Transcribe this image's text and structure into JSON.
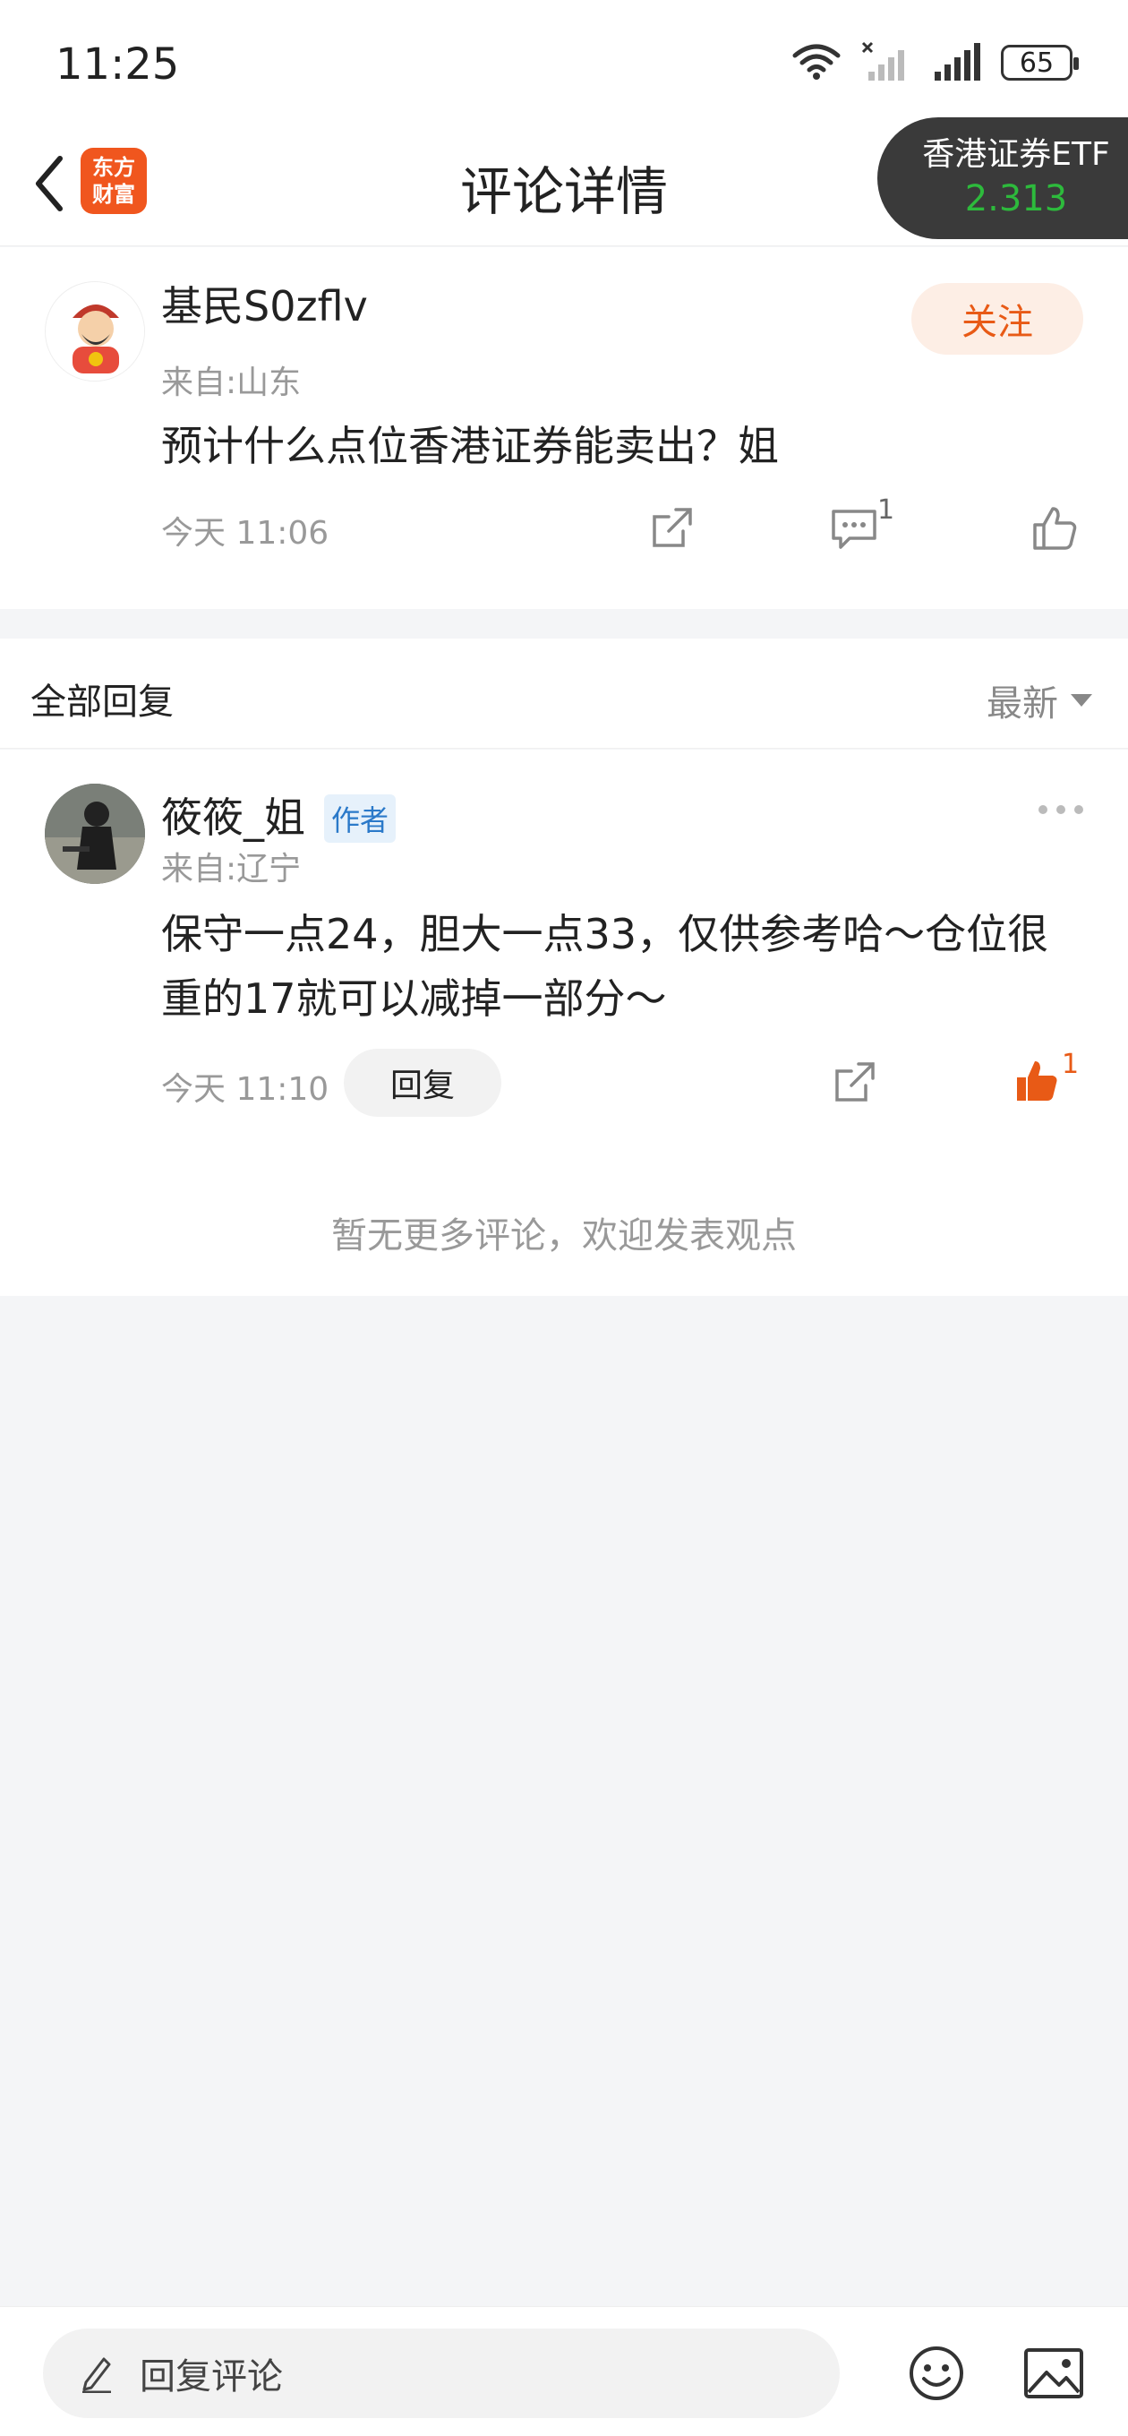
{
  "status_bar": {
    "time": "11:25",
    "battery": "65"
  },
  "nav": {
    "title": "评论详情",
    "logo_line1": "东方",
    "logo_line2": "财富",
    "stock_name": "香港证券ETF",
    "stock_price": "2.313"
  },
  "post": {
    "username": "基民S0zflv",
    "from": "来自:山东",
    "content": "预计什么点位香港证券能卖出？姐",
    "time": "今天 11:06",
    "follow_label": "关注",
    "comment_count": "1"
  },
  "replies_header": {
    "title": "全部回复",
    "sort_label": "最新"
  },
  "reply": {
    "username": "筱筱_姐",
    "author_tag": "作者",
    "from": "来自:辽宁",
    "content": "保守一点24，胆大一点33，仅供参考哈～仓位很重的17就可以减掉一部分～",
    "time": "今天 11:10",
    "reply_label": "回复",
    "like_count": "1"
  },
  "no_more_text": "暂无更多评论，欢迎发表观点",
  "bottom": {
    "input_placeholder": "回复评论"
  },
  "colors": {
    "accent": "#e85a16",
    "price_green": "#2dba3c",
    "author_blue": "#2a79c9"
  }
}
